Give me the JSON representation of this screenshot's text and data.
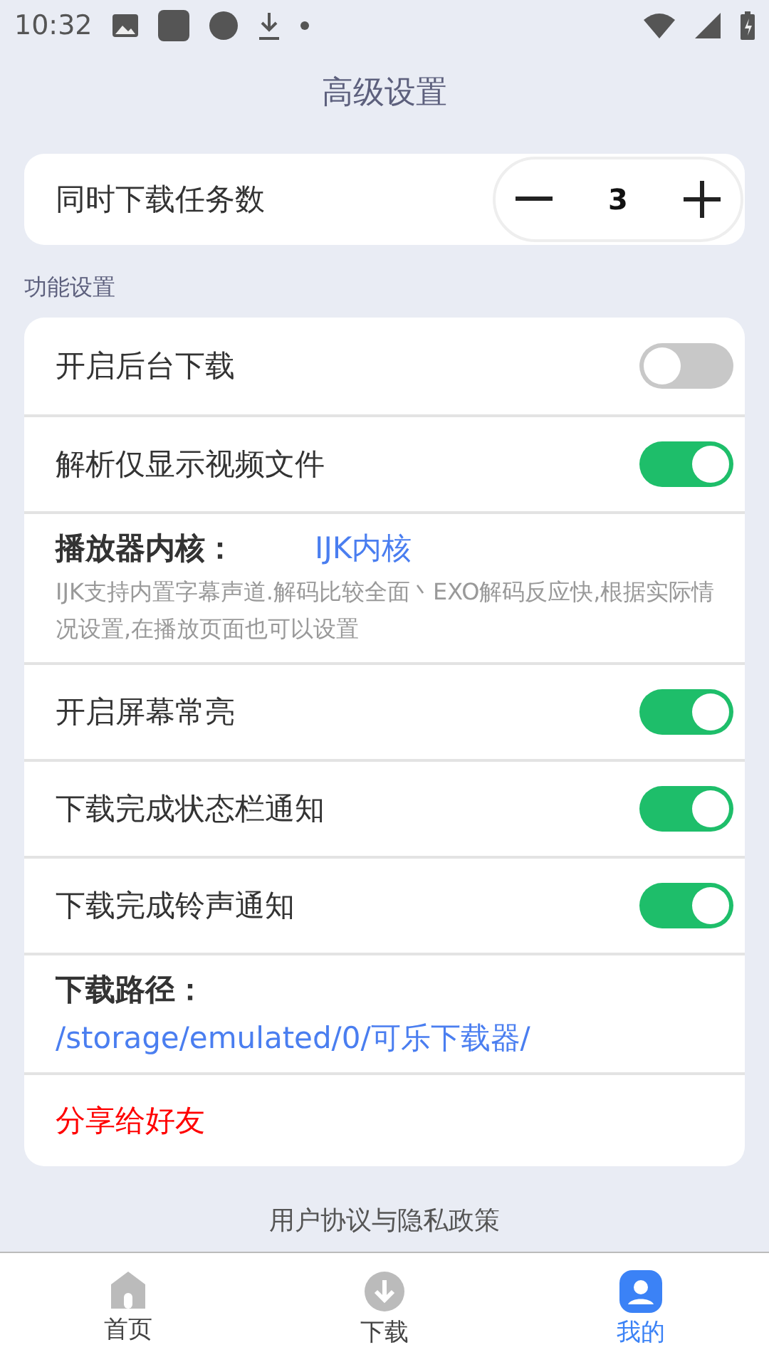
{
  "status_bar": {
    "time": "10:32"
  },
  "title": "高级设置",
  "concurrent": {
    "label": "同时下载任务数",
    "value": "3"
  },
  "section": "功能设置",
  "settings": [
    {
      "kind": "toggle",
      "label": "开启后台下载",
      "on": false
    },
    {
      "kind": "toggle",
      "label": "解析仅显示视频文件",
      "on": true
    },
    {
      "kind": "player",
      "label": "播放器内核：",
      "value": "IJK内核",
      "note": "IJK支持内置字幕声道.解码比较全面丶EXO解码反应快,根据实际情况设置,在播放页面也可以设置"
    },
    {
      "kind": "toggle",
      "label": "开启屏幕常亮",
      "on": true
    },
    {
      "kind": "toggle",
      "label": "下载完成状态栏通知",
      "on": true
    },
    {
      "kind": "toggle",
      "label": "下载完成铃声通知",
      "on": true
    },
    {
      "kind": "path",
      "label": "下载路径：",
      "value": "/storage/emulated/0/可乐下载器/"
    },
    {
      "kind": "share",
      "label": "分享给好友"
    }
  ],
  "footer_link": "用户协议与隐私政策",
  "nav": [
    {
      "label": "首页",
      "kind": "home",
      "selected": false
    },
    {
      "label": "下载",
      "kind": "download",
      "selected": false
    },
    {
      "label": "我的",
      "kind": "user",
      "selected": true
    }
  ]
}
